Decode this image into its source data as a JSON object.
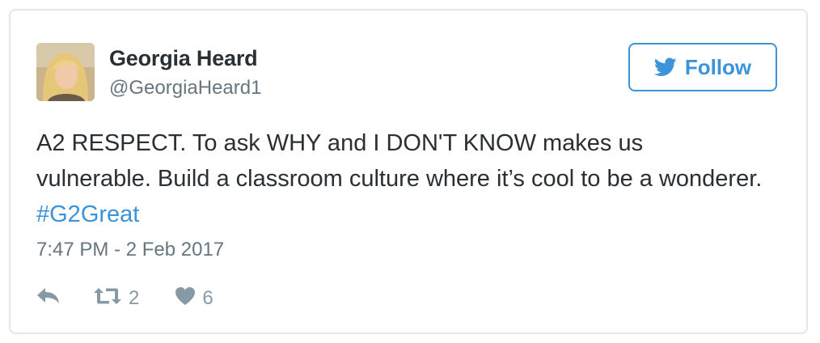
{
  "tweet": {
    "author_name": "Georgia Heard",
    "author_handle": "@GeorgiaHeard1",
    "follow_label": "Follow",
    "text_before": "A2 RESPECT. To ask WHY and I DON'T KNOW makes us vulnerable. Build a classroom culture where it’s cool to be a wonderer. ",
    "hashtag": "#G2Great",
    "timestamp": "7:47 PM - 2 Feb 2017",
    "retweet_count": "2",
    "like_count": "6"
  },
  "colors": {
    "accent": "#3b94d9",
    "text": "#292f33",
    "muted": "#66757f",
    "icon": "#8899a6",
    "border": "#e1e8ed"
  },
  "icons": {
    "follow": "twitter-bird-icon",
    "reply": "reply-icon",
    "retweet": "retweet-icon",
    "like": "heart-icon"
  }
}
